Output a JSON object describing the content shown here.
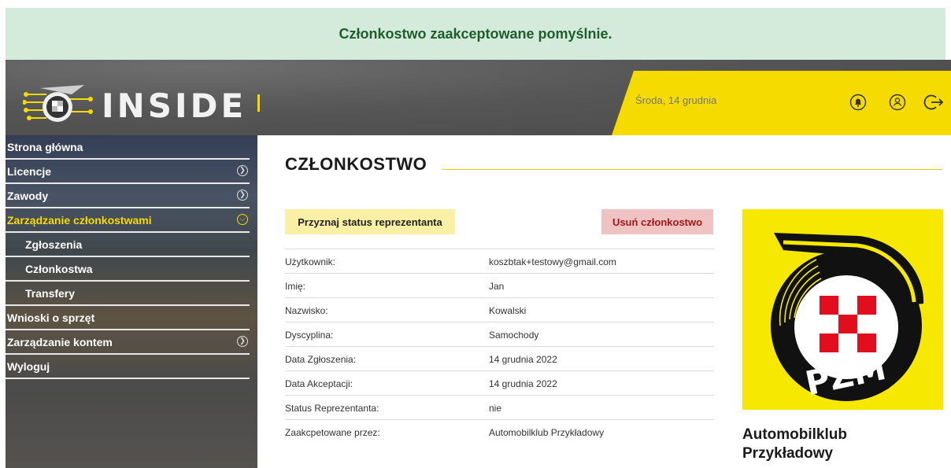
{
  "alert": {
    "message": "Członkostwo zaakceptowane pomyślnie."
  },
  "header": {
    "logo_text": "INSIDE",
    "date": "Środa, 14 grudnia",
    "icons": [
      "bell-icon",
      "user-icon",
      "logout-icon"
    ]
  },
  "sidebar": {
    "items": [
      {
        "label": "Strona główna",
        "chevron": false,
        "sub": false,
        "active": false
      },
      {
        "label": "Licencje",
        "chevron": true,
        "sub": false,
        "active": false
      },
      {
        "label": "Zawody",
        "chevron": true,
        "sub": false,
        "active": false
      },
      {
        "label": "Zarządzanie członkostwami",
        "chevron": true,
        "sub": false,
        "active": true
      },
      {
        "label": "Zgłoszenia",
        "chevron": false,
        "sub": true,
        "active": false
      },
      {
        "label": "Członkostwa",
        "chevron": false,
        "sub": true,
        "active": false
      },
      {
        "label": "Transfery",
        "chevron": false,
        "sub": true,
        "active": false
      },
      {
        "label": "Wnioski o sprzęt",
        "chevron": false,
        "sub": false,
        "active": false
      },
      {
        "label": "Zarządzanie kontem",
        "chevron": true,
        "sub": false,
        "active": false
      },
      {
        "label": "Wyloguj",
        "chevron": false,
        "sub": false,
        "active": false
      }
    ]
  },
  "main": {
    "title": "CZŁONKOSTWO",
    "grant_button": "Przyznaj status reprezentanta",
    "remove_button": "Usuń członkostwo",
    "details": [
      {
        "label": "Użytkownik:",
        "value": "koszbtak+testowy@gmail.com"
      },
      {
        "label": "Imię:",
        "value": "Jan"
      },
      {
        "label": "Nazwisko:",
        "value": "Kowalski"
      },
      {
        "label": "Dyscyplina:",
        "value": "Samochody"
      },
      {
        "label": "Data Zgłoszenia:",
        "value": "14 grudnia 2022"
      },
      {
        "label": "Data Akceptacji:",
        "value": "14 grudnia 2022"
      },
      {
        "label": "Status Reprezentanta:",
        "value": "nie"
      },
      {
        "label": "Zaakcpetowane przez:",
        "value": "Automobilklub Przykładowy"
      }
    ],
    "club_logo_text": "PZM",
    "club_name_line1": "Automobilklub",
    "club_name_line2": "Przykładowy"
  },
  "colors": {
    "accent_yellow": "#f6db00",
    "success_bg": "#d4ebdc",
    "success_text": "#1e5e2a",
    "danger_bg": "#f0c3c3",
    "danger_text": "#a01818"
  }
}
